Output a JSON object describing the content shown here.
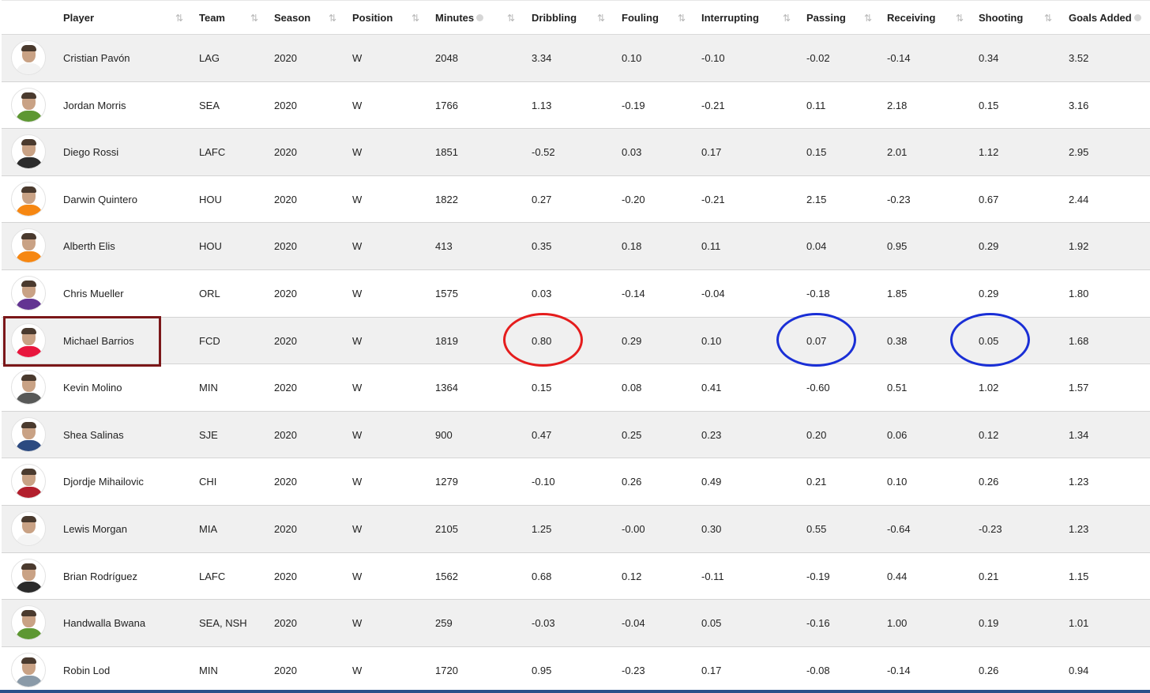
{
  "columns": [
    {
      "key": "player",
      "label": "Player",
      "sortable": true
    },
    {
      "key": "team",
      "label": "Team",
      "sortable": true
    },
    {
      "key": "season",
      "label": "Season",
      "sortable": true
    },
    {
      "key": "position",
      "label": "Position",
      "sortable": true
    },
    {
      "key": "minutes",
      "label": "Minutes",
      "sortable": true,
      "info": true
    },
    {
      "key": "dribbling",
      "label": "Dribbling",
      "sortable": true
    },
    {
      "key": "fouling",
      "label": "Fouling",
      "sortable": true
    },
    {
      "key": "interrupting",
      "label": "Interrupting",
      "sortable": true
    },
    {
      "key": "passing",
      "label": "Passing",
      "sortable": true
    },
    {
      "key": "receiving",
      "label": "Receiving",
      "sortable": true
    },
    {
      "key": "shooting",
      "label": "Shooting",
      "sortable": true
    },
    {
      "key": "goals_added",
      "label": "Goals Added",
      "sortable": false,
      "info": true
    }
  ],
  "sort_icon": "⇅",
  "rows": [
    {
      "player": "Cristian Pavón",
      "team": "LAG",
      "season": "2020",
      "position": "W",
      "minutes": "2048",
      "dribbling": "3.34",
      "fouling": "0.10",
      "interrupting": "-0.10",
      "passing": "-0.02",
      "receiving": "-0.14",
      "shooting": "0.34",
      "goals_added": "3.52",
      "kit_color": "#f2f2f2"
    },
    {
      "player": "Jordan Morris",
      "team": "SEA",
      "season": "2020",
      "position": "W",
      "minutes": "1766",
      "dribbling": "1.13",
      "fouling": "-0.19",
      "interrupting": "-0.21",
      "passing": "0.11",
      "receiving": "2.18",
      "shooting": "0.15",
      "goals_added": "3.16",
      "kit_color": "#5d9732"
    },
    {
      "player": "Diego Rossi",
      "team": "LAFC",
      "season": "2020",
      "position": "W",
      "minutes": "1851",
      "dribbling": "-0.52",
      "fouling": "0.03",
      "interrupting": "0.17",
      "passing": "0.15",
      "receiving": "2.01",
      "shooting": "1.12",
      "goals_added": "2.95",
      "kit_color": "#2b2b2b"
    },
    {
      "player": "Darwin Quintero",
      "team": "HOU",
      "season": "2020",
      "position": "W",
      "minutes": "1822",
      "dribbling": "0.27",
      "fouling": "-0.20",
      "interrupting": "-0.21",
      "passing": "2.15",
      "receiving": "-0.23",
      "shooting": "0.67",
      "goals_added": "2.44",
      "kit_color": "#f68712"
    },
    {
      "player": "Alberth Elis",
      "team": "HOU",
      "season": "2020",
      "position": "W",
      "minutes": "413",
      "dribbling": "0.35",
      "fouling": "0.18",
      "interrupting": "0.11",
      "passing": "0.04",
      "receiving": "0.95",
      "shooting": "0.29",
      "goals_added": "1.92",
      "kit_color": "#f68712"
    },
    {
      "player": "Chris Mueller",
      "team": "ORL",
      "season": "2020",
      "position": "W",
      "minutes": "1575",
      "dribbling": "0.03",
      "fouling": "-0.14",
      "interrupting": "-0.04",
      "passing": "-0.18",
      "receiving": "1.85",
      "shooting": "0.29",
      "goals_added": "1.80",
      "kit_color": "#633492"
    },
    {
      "player": "Michael Barrios",
      "team": "FCD",
      "season": "2020",
      "position": "W",
      "minutes": "1819",
      "dribbling": "0.80",
      "fouling": "0.29",
      "interrupting": "0.10",
      "passing": "0.07",
      "receiving": "0.38",
      "shooting": "0.05",
      "goals_added": "1.68",
      "kit_color": "#e8163d"
    },
    {
      "player": "Kevin Molino",
      "team": "MIN",
      "season": "2020",
      "position": "W",
      "minutes": "1364",
      "dribbling": "0.15",
      "fouling": "0.08",
      "interrupting": "0.41",
      "passing": "-0.60",
      "receiving": "0.51",
      "shooting": "1.02",
      "goals_added": "1.57",
      "kit_color": "#585958"
    },
    {
      "player": "Shea Salinas",
      "team": "SJE",
      "season": "2020",
      "position": "W",
      "minutes": "900",
      "dribbling": "0.47",
      "fouling": "0.25",
      "interrupting": "0.23",
      "passing": "0.20",
      "receiving": "0.06",
      "shooting": "0.12",
      "goals_added": "1.34",
      "kit_color": "#2c4a80"
    },
    {
      "player": "Djordje Mihailovic",
      "team": "CHI",
      "season": "2020",
      "position": "W",
      "minutes": "1279",
      "dribbling": "-0.10",
      "fouling": "0.26",
      "interrupting": "0.49",
      "passing": "0.21",
      "receiving": "0.10",
      "shooting": "0.26",
      "goals_added": "1.23",
      "kit_color": "#b21f2d"
    },
    {
      "player": "Lewis Morgan",
      "team": "MIA",
      "season": "2020",
      "position": "W",
      "minutes": "2105",
      "dribbling": "1.25",
      "fouling": "-0.00",
      "interrupting": "0.30",
      "passing": "0.55",
      "receiving": "-0.64",
      "shooting": "-0.23",
      "goals_added": "1.23",
      "kit_color": "#f4f4f4"
    },
    {
      "player": "Brian Rodríguez",
      "team": "LAFC",
      "season": "2020",
      "position": "W",
      "minutes": "1562",
      "dribbling": "0.68",
      "fouling": "0.12",
      "interrupting": "-0.11",
      "passing": "-0.19",
      "receiving": "0.44",
      "shooting": "0.21",
      "goals_added": "1.15",
      "kit_color": "#2b2b2b"
    },
    {
      "player": "Handwalla Bwana",
      "team": "SEA, NSH",
      "season": "2020",
      "position": "W",
      "minutes": "259",
      "dribbling": "-0.03",
      "fouling": "-0.04",
      "interrupting": "0.05",
      "passing": "-0.16",
      "receiving": "1.00",
      "shooting": "0.19",
      "goals_added": "1.01",
      "kit_color": "#5d9732"
    },
    {
      "player": "Robin Lod",
      "team": "MIN",
      "season": "2020",
      "position": "W",
      "minutes": "1720",
      "dribbling": "0.95",
      "fouling": "-0.23",
      "interrupting": "0.17",
      "passing": "-0.08",
      "receiving": "-0.14",
      "shooting": "0.26",
      "goals_added": "0.94",
      "kit_color": "#8a9aa8"
    }
  ],
  "annotations": {
    "highlighted_player": "Michael Barrios",
    "red_circle_stat": "dribbling",
    "blue_circle_stats": [
      "passing",
      "shooting"
    ],
    "colors": {
      "box": "#7b1719",
      "red": "#e51d1d",
      "blue": "#1a2fd6"
    }
  }
}
